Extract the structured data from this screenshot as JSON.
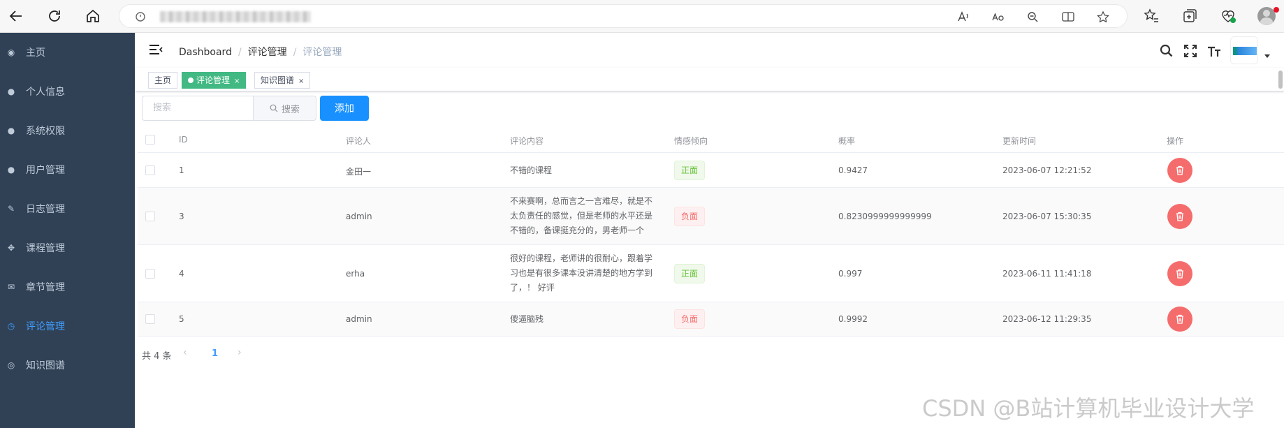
{
  "sidebar": {
    "items": [
      {
        "label": "主页",
        "icon": "dashboard-icon"
      },
      {
        "label": "个人信息",
        "icon": "user-icon"
      },
      {
        "label": "系统权限",
        "icon": "user-icon"
      },
      {
        "label": "用户管理",
        "icon": "peoples-icon"
      },
      {
        "label": "日志管理",
        "icon": "edit-icon"
      },
      {
        "label": "课程管理",
        "icon": "drag-icon"
      },
      {
        "label": "章节管理",
        "icon": "message-icon"
      },
      {
        "label": "评论管理",
        "icon": "time-icon",
        "active": true
      },
      {
        "label": "知识图谱",
        "icon": "compass-icon"
      }
    ],
    "bg": "#304156",
    "active_color": "#409eff"
  },
  "breadcrumb": [
    "Dashboard",
    "评论管理",
    "评论管理"
  ],
  "tags": [
    {
      "label": "主页"
    },
    {
      "label": "评论管理",
      "close": "×",
      "active": true
    },
    {
      "label": "知识图谱",
      "close": "×"
    }
  ],
  "toolbar": {
    "search_placeholder": "搜索",
    "search_button": "搜索",
    "add_button": "添加"
  },
  "table": {
    "columns": [
      "ID",
      "评论人",
      "评论内容",
      "情感倾向",
      "概率",
      "更新时间",
      "操作"
    ],
    "rows": [
      {
        "id": "1",
        "user": "金田一",
        "content": "不错的课程",
        "sentiment": "正面",
        "prob": "0.9427",
        "time": "2023-06-07 12:21:52"
      },
      {
        "id": "3",
        "user": "admin",
        "content": "不来赛啊，总而言之一言难尽，就是不太负责任的感觉，但是老师的水平还是不错的，备课挺充分的，男老师一个",
        "sentiment": "负面",
        "prob": "0.8230999999999999",
        "time": "2023-06-07 15:30:35"
      },
      {
        "id": "4",
        "user": "erha",
        "content": "很好的课程，老师讲的很耐心，跟着学习也是有很多课本没讲清楚的地方学到了，！ 好评",
        "sentiment": "正面",
        "prob": "0.997",
        "time": "2023-06-11 11:41:18"
      },
      {
        "id": "5",
        "user": "admin",
        "content": "傻逼脑残",
        "sentiment": "负面",
        "prob": "0.9992",
        "time": "2023-06-12 11:29:35"
      }
    ]
  },
  "pagination": {
    "total": "共 4 条",
    "page": "1",
    "prev": "‹",
    "next": "›"
  },
  "watermark": "CSDN @B站计算机毕业设计大学",
  "colors": {
    "primary": "#1890ff",
    "tag_active": "#42b983",
    "danger": "#f56c6c",
    "positive": "#67c23a"
  }
}
